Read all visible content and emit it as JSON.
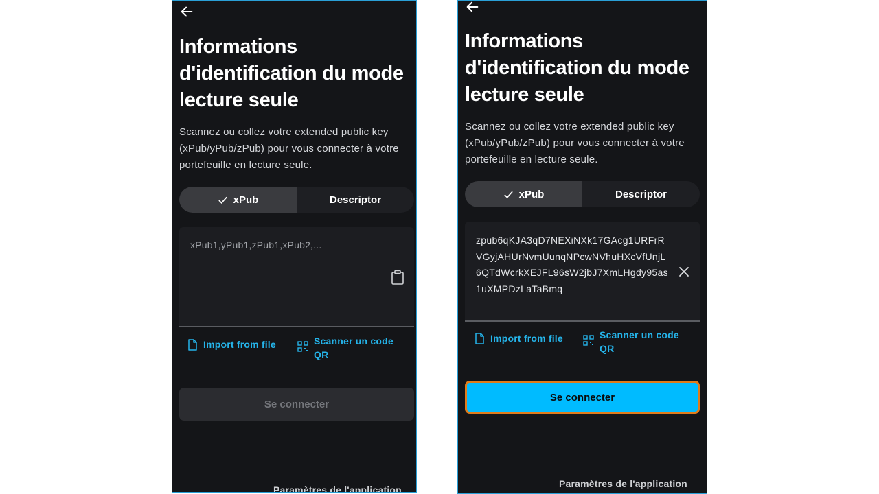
{
  "left": {
    "title": "Informations d'identification du mode lecture seule",
    "description": "Scannez ou collez votre extended public key (xPub/yPub/zPub) pour vous connecter à votre portefeuille en lecture seule.",
    "tabs": [
      {
        "label": "xPub",
        "selected": true
      },
      {
        "label": "Descriptor",
        "selected": false
      }
    ],
    "input": {
      "placeholder": "xPub1,yPub1,zPub1,xPub2,...",
      "value": ""
    },
    "import_label": "Import from file",
    "scan_label": "Scanner un code QR",
    "connect_label": "Se connecter",
    "connect_state": "disabled",
    "footer": "Paramètres de l'application"
  },
  "right": {
    "title": "Informations d'identification du mode lecture seule",
    "description": "Scannez ou collez votre extended public key (xPub/yPub/zPub) pour vous connecter à votre portefeuille en lecture seule.",
    "tabs": [
      {
        "label": "xPub",
        "selected": true
      },
      {
        "label": "Descriptor",
        "selected": false
      }
    ],
    "input": {
      "value": "zpub6qKJA3qD7NEXiNXk17GAcg1URFrRVGyjAHUrNvmUunqNPcwNVhuHXcVfUnjL6QTdWcrkXEJFL96sW2jbJ7XmLHgdy95as1uXMPDzLaTaBmq"
    },
    "import_label": "Import from file",
    "scan_label": "Scanner un code QR",
    "connect_label": "Se connecter",
    "connect_state": "enabled",
    "footer": "Paramètres de l'application"
  },
  "colors": {
    "accent": "#25b4ea",
    "button_enabled": "#00bbff",
    "highlight": "#e07b1a",
    "background": "#141518"
  }
}
